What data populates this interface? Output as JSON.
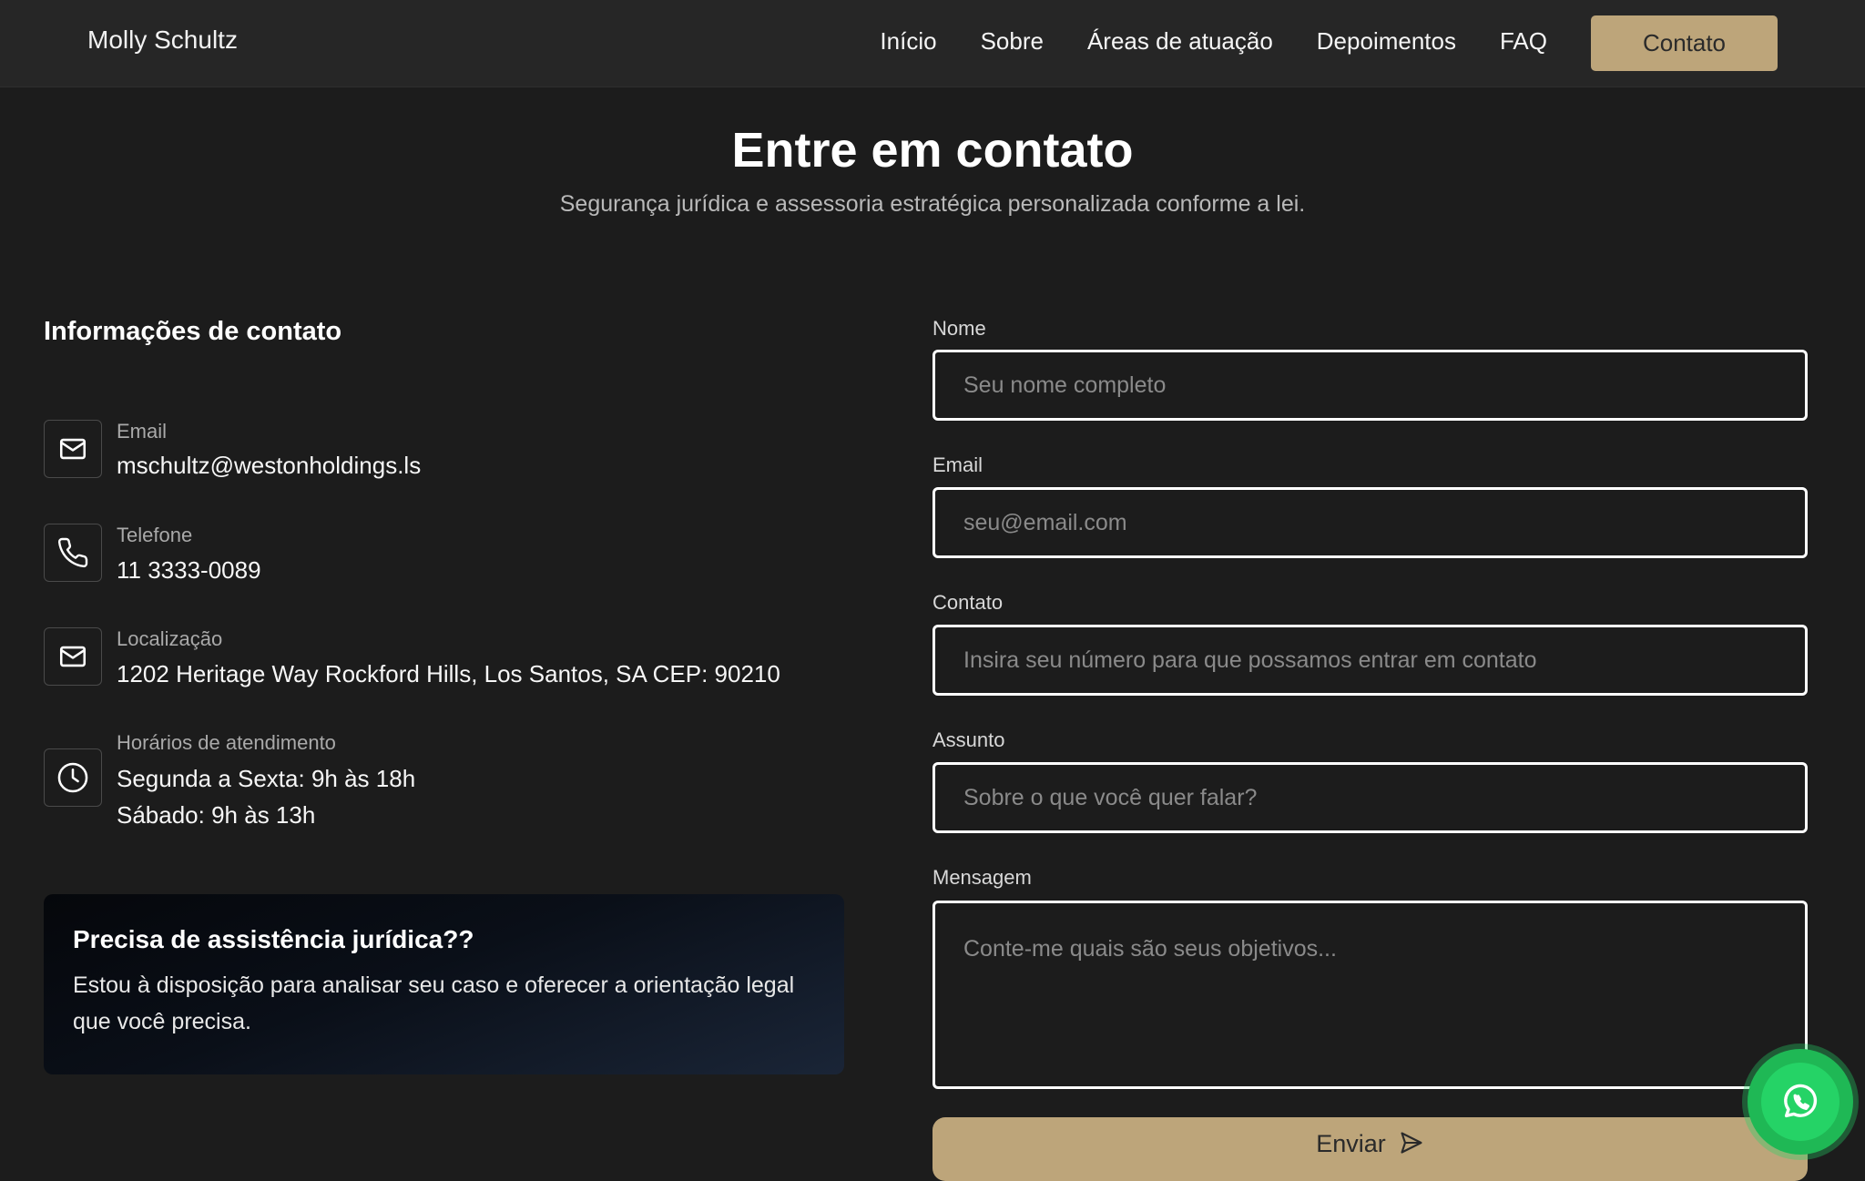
{
  "header": {
    "brand": "Molly Schultz",
    "nav": [
      "Início",
      "Sobre",
      "Áreas de atuação",
      "Depoimentos",
      "FAQ"
    ],
    "cta_label": "Contato"
  },
  "hero": {
    "title": "Entre em contato",
    "subtitle": "Segurança jurídica e assessoria estratégica personalizada conforme a lei."
  },
  "contact_info": {
    "heading": "Informações de contato",
    "items": [
      {
        "label": "Email",
        "icon": "mail-icon",
        "lines": [
          "mschultz@westonholdings.ls"
        ]
      },
      {
        "label": "Telefone",
        "icon": "phone-icon",
        "lines": [
          "11 3333-0089"
        ]
      },
      {
        "label": "Localização",
        "icon": "mail-icon",
        "lines": [
          "1202 Heritage Way Rockford Hills, Los Santos, SA CEP: 90210"
        ]
      },
      {
        "label": "Horários de atendimento",
        "icon": "clock-icon",
        "lines": [
          "Segunda a Sexta: 9h às 18h",
          "Sábado: 9h às 13h"
        ]
      }
    ]
  },
  "help_card": {
    "title": "Precisa de assistência jurídica??",
    "text": "Estou à disposição para analisar seu caso e oferecer a orientação legal que você precisa."
  },
  "form": {
    "fields": [
      {
        "label": "Nome",
        "placeholder": "Seu nome completo",
        "value": ""
      },
      {
        "label": "Email",
        "placeholder": "seu@email.com",
        "value": ""
      },
      {
        "label": "Contato",
        "placeholder": "Insira seu número para que possamos entrar em contato",
        "value": ""
      },
      {
        "label": "Assunto",
        "placeholder": "Sobre o que você quer falar?",
        "value": ""
      },
      {
        "label": "Mensagem",
        "placeholder": "Conte-me quais são seus objetivos...",
        "value": ""
      }
    ],
    "submit_label": "Enviar"
  },
  "colors": {
    "accent": "#bda57a",
    "background": "#1c1c1c",
    "navbar": "#262626",
    "whatsapp": "#25d366"
  },
  "floating": {
    "icon": "whatsapp-icon"
  }
}
